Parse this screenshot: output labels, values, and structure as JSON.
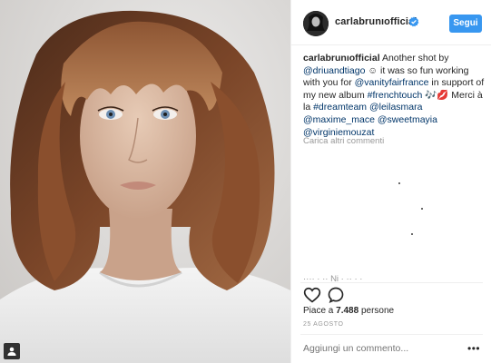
{
  "post": {
    "username": "carlabrunıofficial",
    "follow_label": "Segui",
    "caption_username": "carlabrunıofficial",
    "caption_parts": [
      {
        "text": " Another shot by ",
        "link": false
      },
      {
        "text": "@driuandtiago",
        "link": true
      },
      {
        "text": " ☺ it was so fun working with you for ",
        "link": false
      },
      {
        "text": "@vanityfairfrance",
        "link": true
      },
      {
        "text": " in support of my new album ",
        "link": false
      },
      {
        "text": "#frenchtouch",
        "link": true
      },
      {
        "text": " 🎶💋 Merci à la ",
        "link": false
      },
      {
        "text": "#dreamteam",
        "link": true
      },
      {
        "text": " ",
        "link": false
      },
      {
        "text": "@leilasmara",
        "link": true
      },
      {
        "text": " ",
        "link": false
      },
      {
        "text": "@maxime_mace",
        "link": true
      },
      {
        "text": " ",
        "link": false
      },
      {
        "text": "@sweetmayia",
        "link": true
      },
      {
        "text": " ",
        "link": false
      },
      {
        "text": "@virginiemouzat",
        "link": true
      }
    ],
    "load_more_comments": "Carica altri commenti",
    "partial_comment": "···· · ·· Ni · ·· · ·",
    "likes_prefix": "Piace a ",
    "likes_count": "7.488",
    "likes_suffix": " persone",
    "date": "25 AGOSTO",
    "comment_placeholder": "Aggiungi un commento...",
    "more_options": "•••"
  },
  "icons": {
    "verified": "verified-badge-icon",
    "like": "heart-icon",
    "comment": "speech-bubble-icon",
    "user_tag": "user-tag-icon"
  },
  "colors": {
    "accent": "#3897f0",
    "link": "#003569",
    "text": "#262626",
    "muted": "#999999",
    "border": "#efefef"
  }
}
